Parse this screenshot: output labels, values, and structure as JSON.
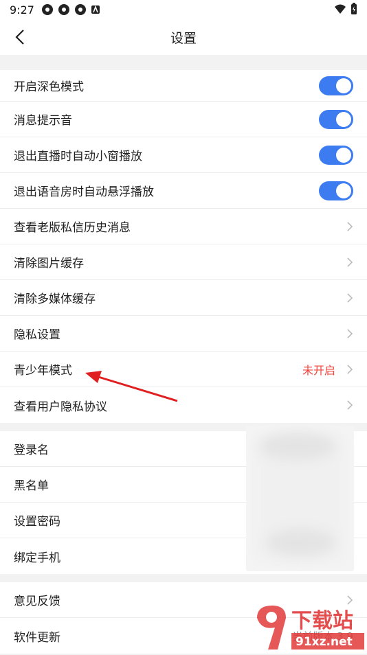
{
  "status_bar": {
    "time": "9:27"
  },
  "header": {
    "title": "设置"
  },
  "group1": [
    {
      "label": "开启深色模式",
      "toggle": true
    },
    {
      "label": "消息提示音",
      "toggle": true
    },
    {
      "label": "退出直播时自动小窗播放",
      "toggle": true
    },
    {
      "label": "退出语音房时自动悬浮播放",
      "toggle": true
    },
    {
      "label": "查看老版私信历史消息"
    },
    {
      "label": "清除图片缓存"
    },
    {
      "label": "清除多媒体缓存"
    },
    {
      "label": "隐私设置"
    },
    {
      "label": "青少年模式",
      "status": "未开启"
    },
    {
      "label": "查看用户隐私协议"
    }
  ],
  "group2": [
    {
      "label": "登录名"
    },
    {
      "label": "黑名单"
    },
    {
      "label": "设置密码"
    },
    {
      "label": "绑定手机"
    }
  ],
  "group3": [
    {
      "label": "意见反馈"
    },
    {
      "label": "软件更新",
      "status": "当前版本 3.9"
    }
  ],
  "colors": {
    "accent": "#3d7cf0",
    "status_red": "#f0443d",
    "arrow": "#e02020"
  },
  "watermark": {
    "text": "下载站",
    "url": "91xz.net"
  }
}
